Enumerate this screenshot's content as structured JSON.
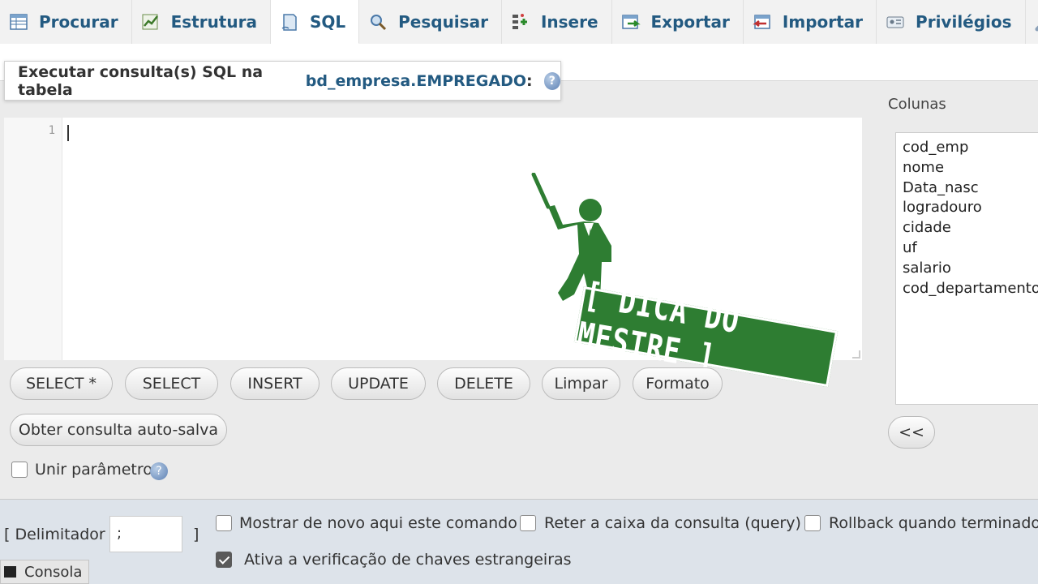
{
  "tabs": [
    {
      "label": "Procurar",
      "icon": "table-browse-icon"
    },
    {
      "label": "Estrutura",
      "icon": "structure-icon"
    },
    {
      "label": "SQL",
      "icon": "sql-icon"
    },
    {
      "label": "Pesquisar",
      "icon": "search-icon"
    },
    {
      "label": "Insere",
      "icon": "insert-icon"
    },
    {
      "label": "Exportar",
      "icon": "export-icon"
    },
    {
      "label": "Importar",
      "icon": "import-icon"
    },
    {
      "label": "Privilégios",
      "icon": "privileges-icon"
    }
  ],
  "query": {
    "title_prefix": "Executar consulta(s) SQL na tabela",
    "table_name": "bd_empresa.EMPREGADO",
    "title_suffix": ":"
  },
  "editor": {
    "line_number": "1",
    "content": ""
  },
  "watermark": {
    "text": "[ DICA DO MESTRE ]",
    "color": "#2e7d32"
  },
  "columns": {
    "label": "Colunas",
    "items": [
      "cod_emp",
      "nome",
      "Data_nasc",
      "logradouro",
      "cidade",
      "uf",
      "salario",
      "cod_departamento"
    ],
    "insert_button": "<<"
  },
  "buttons": {
    "select_all": "SELECT *",
    "select": "SELECT",
    "insert": "INSERT",
    "update": "UPDATE",
    "delete": "DELETE",
    "clear": "Limpar",
    "format": "Formato",
    "get_autosaved": "Obter consulta auto-salva"
  },
  "bind_params": {
    "label": "Unir parâmetros",
    "checked": false
  },
  "bottom": {
    "delimiter_open": "[ Delimitador",
    "delimiter_value": ";",
    "delimiter_close": "]",
    "show_again": {
      "label": "Mostrar de novo aqui este comando",
      "checked": false
    },
    "retain_query": {
      "label": "Reter a caixa da consulta (query)",
      "checked": false
    },
    "rollback": {
      "label": "Rollback quando terminado",
      "checked": false
    },
    "fk_checks": {
      "label": "Ativa a verificação de chaves estrangeiras",
      "checked": true
    },
    "console": "Consola"
  }
}
